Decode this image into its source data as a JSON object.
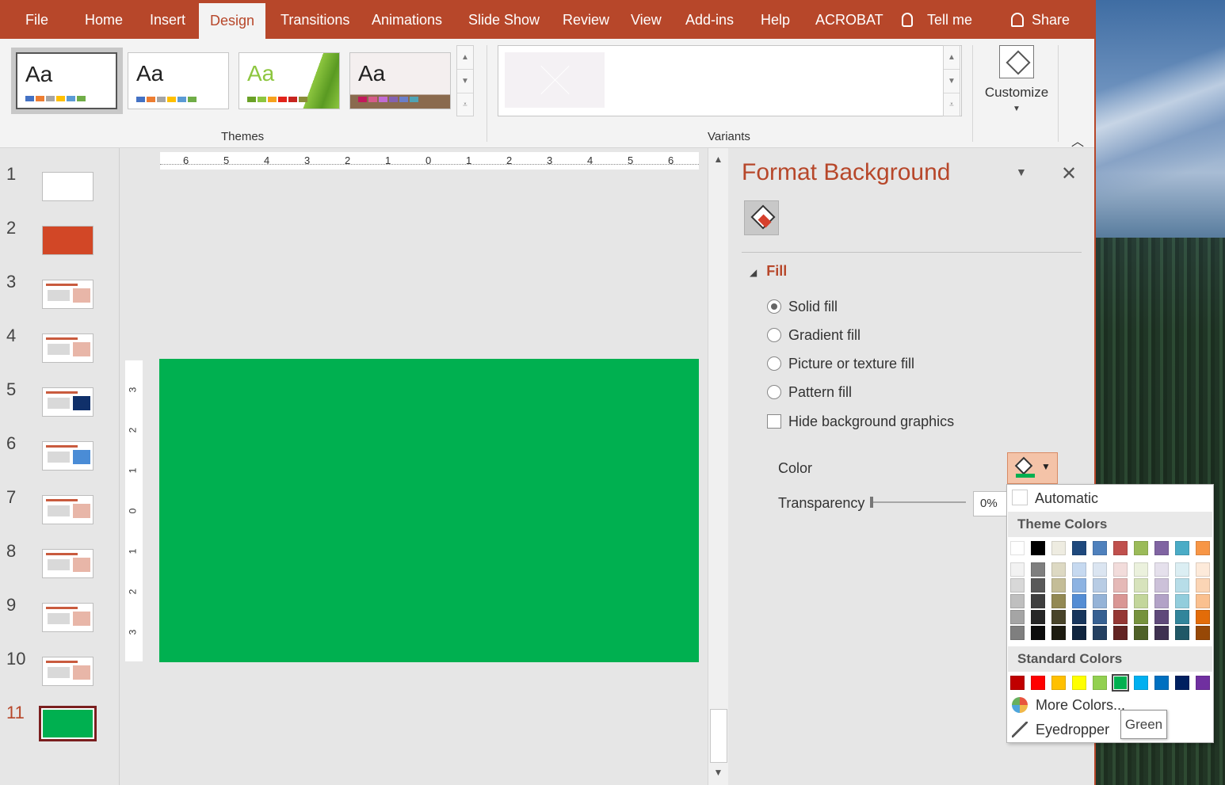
{
  "tabs": [
    {
      "label": "File"
    },
    {
      "label": "Home"
    },
    {
      "label": "Insert"
    },
    {
      "label": "Design"
    },
    {
      "label": "Transitions"
    },
    {
      "label": "Animations"
    },
    {
      "label": "Slide Show"
    },
    {
      "label": "Review"
    },
    {
      "label": "View"
    },
    {
      "label": "Add-ins"
    },
    {
      "label": "Help"
    },
    {
      "label": "ACROBAT"
    },
    {
      "label": "Tell me"
    },
    {
      "label": "Share"
    }
  ],
  "active_tab": "Design",
  "ribbon": {
    "themes": [
      {
        "aa": "Aa",
        "swatches": [
          "#4472c4",
          "#ed7d31",
          "#a5a5a5",
          "#ffc000",
          "#5b9bd5",
          "#70ad47"
        ]
      },
      {
        "aa": "Aa",
        "swatches": [
          "#4472c4",
          "#ed7d31",
          "#a5a5a5",
          "#ffc000",
          "#5b9bd5",
          "#70ad47"
        ]
      },
      {
        "aa": "Aa",
        "swatches": [
          "#6aa127",
          "#8dc63f",
          "#f6a21d",
          "#e2231a",
          "#c6251f",
          "#8b8c3a"
        ]
      },
      {
        "aa": "Aa",
        "swatches": [
          "#c2185b",
          "#d65b8a",
          "#c26bd4",
          "#8461b1",
          "#6b7ec9",
          "#4fa3b5"
        ]
      }
    ],
    "themes_label": "Themes",
    "variants_label": "Variants",
    "customize_label": "Customize"
  },
  "slides": [
    {
      "num": "1"
    },
    {
      "num": "2"
    },
    {
      "num": "3"
    },
    {
      "num": "4"
    },
    {
      "num": "5"
    },
    {
      "num": "6"
    },
    {
      "num": "7"
    },
    {
      "num": "8"
    },
    {
      "num": "9"
    },
    {
      "num": "10"
    },
    {
      "num": "11"
    }
  ],
  "selected_slide": "11",
  "slide_background": "#00b050",
  "rulers": {
    "horizontal": [
      "6",
      "5",
      "4",
      "3",
      "2",
      "1",
      "0",
      "1",
      "2",
      "3",
      "4",
      "5",
      "6"
    ],
    "vertical": [
      "3",
      "2",
      "1",
      "0",
      "1",
      "2",
      "3"
    ]
  },
  "format_pane": {
    "title": "Format Background",
    "section": "Fill",
    "options": [
      {
        "label": "Solid fill",
        "checked": true
      },
      {
        "label": "Gradient fill",
        "checked": false
      },
      {
        "label": "Picture or texture fill",
        "checked": false
      },
      {
        "label": "Pattern fill",
        "checked": false
      }
    ],
    "hide_graphics_label": "Hide background graphics",
    "color_label": "Color",
    "transparency_label": "Transparency",
    "transparency_value": "0%"
  },
  "color_popup": {
    "automatic": "Automatic",
    "theme_colors_label": "Theme Colors",
    "standard_colors_label": "Standard Colors",
    "more_colors": "More Colors...",
    "eyedropper": "Eyedropper",
    "tooltip": "Green",
    "theme_top": [
      "#ffffff",
      "#000000",
      "#eeece1",
      "#1f497d",
      "#4f81bd",
      "#c0504d",
      "#9bbb59",
      "#8064a2",
      "#4bacc6",
      "#f79646"
    ],
    "theme_shades": [
      [
        "#f2f2f2",
        "#7f7f7f",
        "#ddd9c3",
        "#c6d9f0",
        "#dbe5f1",
        "#f2dcdb",
        "#ebf1dd",
        "#e5e0ec",
        "#dbeef3",
        "#fdeada"
      ],
      [
        "#d8d8d8",
        "#595959",
        "#c4bd97",
        "#8db3e2",
        "#b8cce4",
        "#e5b9b7",
        "#d7e3bc",
        "#ccc1d9",
        "#b7dde8",
        "#fbd5b5"
      ],
      [
        "#bfbfbf",
        "#3f3f3f",
        "#938953",
        "#548dd4",
        "#95b3d7",
        "#d99694",
        "#c3d69b",
        "#b2a2c7",
        "#92cddc",
        "#fac08f"
      ],
      [
        "#a5a5a5",
        "#262626",
        "#494429",
        "#17365d",
        "#366092",
        "#953734",
        "#76923c",
        "#5f497a",
        "#31859b",
        "#e36c09"
      ],
      [
        "#7f7f7f",
        "#0c0c0c",
        "#1d1b10",
        "#0f243e",
        "#244061",
        "#632423",
        "#4f6128",
        "#3f3151",
        "#205867",
        "#974806"
      ]
    ],
    "standard": [
      "#c00000",
      "#ff0000",
      "#ffc000",
      "#ffff00",
      "#92d050",
      "#00b050",
      "#00b0f0",
      "#0070c0",
      "#002060",
      "#7030a0"
    ],
    "selected_standard": "#00b050"
  }
}
